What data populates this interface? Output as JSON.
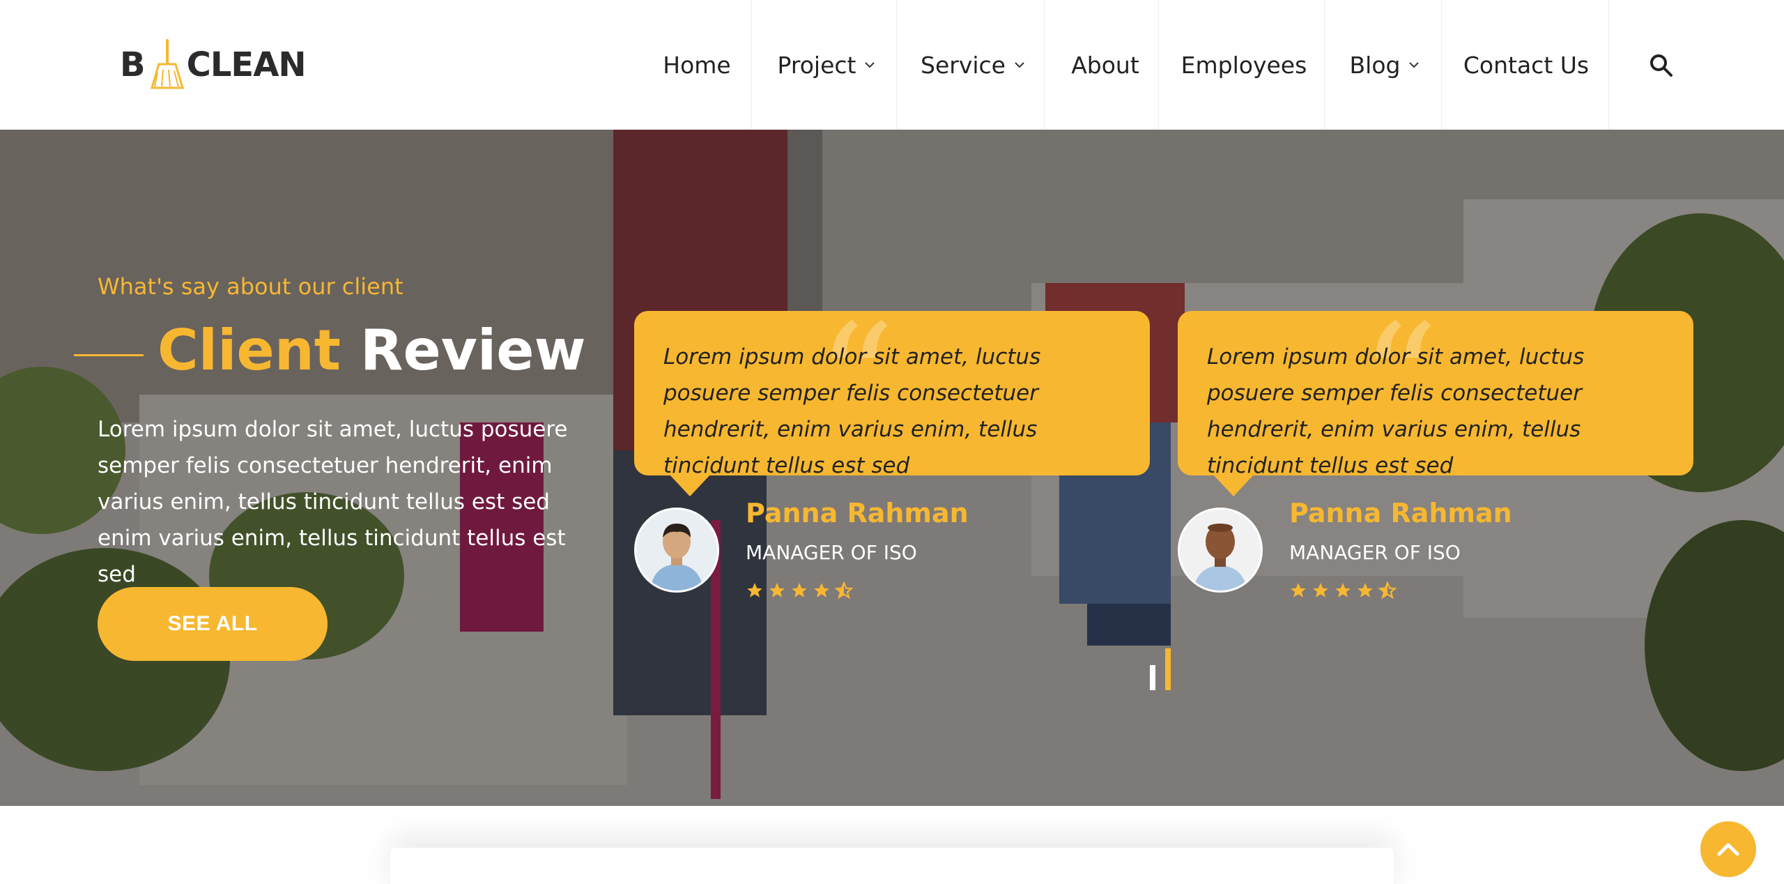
{
  "brand": {
    "logo_left": "B",
    "logo_right": "CLEAN",
    "accent": "#f7b731"
  },
  "nav": {
    "items": [
      {
        "label": "Home",
        "has_dropdown": false
      },
      {
        "label": "Project",
        "has_dropdown": true
      },
      {
        "label": "Service",
        "has_dropdown": true
      },
      {
        "label": "About",
        "has_dropdown": false
      },
      {
        "label": "Employees",
        "has_dropdown": false
      },
      {
        "label": "Blog",
        "has_dropdown": true
      },
      {
        "label": "Contact Us",
        "has_dropdown": false
      }
    ],
    "search_icon": "search-icon"
  },
  "hero": {
    "eyebrow": "What's say about our client",
    "title_highlight": "Client",
    "title_rest": "Review",
    "intro": "Lorem ipsum dolor sit amet, luctus posuere semper felis consectetuer hendrerit, enim varius enim, tellus tincidunt tellus est sed enim varius enim, tellus tincidunt tellus est sed",
    "button": "SEE ALL"
  },
  "reviews": [
    {
      "text": "Lorem ipsum dolor sit amet, luctus posuere semper felis consectetuer hendrerit, enim varius enim, tellus tincidunt tellus est sed",
      "name": "Panna Rahman",
      "role": "MANAGER OF ISO",
      "rating": 4.5
    },
    {
      "text": "Lorem ipsum dolor sit amet, luctus posuere semper felis consectetuer hendrerit, enim varius enim, tellus tincidunt tellus est sed",
      "name": "Panna Rahman",
      "role": "MANAGER OF ISO",
      "rating": 4.5
    }
  ],
  "carousel": {
    "active_index": 1,
    "count": 2
  },
  "scroll_top_icon": "chevron-up-icon"
}
